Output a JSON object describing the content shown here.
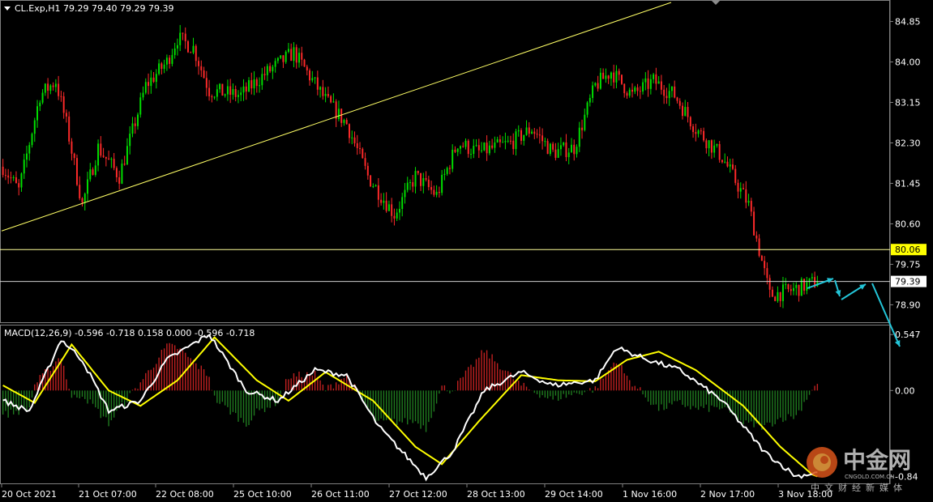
{
  "window": {
    "symbol_header": "CL.Exp,H1  79.29 79.40 79.29 79.39"
  },
  "colors": {
    "background": "#000000",
    "bull_candle": "#00e000",
    "bear_candle": "#ff2a2a",
    "trendline": "#ffff66",
    "hline": "#ffff99",
    "macd_line": "#ffffff",
    "signal_line": "#ffff00",
    "hist_pos": "#c02020",
    "hist_neg": "#1f7a1f",
    "arrow": "#23c5d8",
    "price_tag_yellow": "#ffff00",
    "price_tag_white": "#ffffff",
    "grid_border": "#808080"
  },
  "chart_data": [
    {
      "type": "candlestick",
      "title": "CL.Exp,H1",
      "ohlc_last": {
        "open": 79.29,
        "high": 79.4,
        "low": 79.29,
        "close": 79.39
      },
      "ylim": [
        78.55,
        85.25
      ],
      "y_ticks": [
        "84.85",
        "84.00",
        "83.15",
        "82.30",
        "81.45",
        "80.60",
        "79.75",
        "78.90"
      ],
      "y_tick_values": [
        84.85,
        84.0,
        83.15,
        82.3,
        81.45,
        80.6,
        79.75,
        78.9
      ],
      "x_ticks": [
        "20 Oct 2021",
        "21 Oct 07:00",
        "22 Oct 08:00",
        "25 Oct 10:00",
        "26 Oct 11:00",
        "27 Oct 12:00",
        "28 Oct 13:00",
        "29 Oct 14:00",
        "1 Nov 16:00",
        "2 Nov 17:00",
        "3 Nov 18:00"
      ],
      "horizontal_levels": [
        {
          "value": 80.06,
          "label": "80.06",
          "tag": "yellow"
        },
        {
          "value": 79.39,
          "label": "79.39",
          "tag": "white"
        }
      ],
      "trendline": {
        "from_value": 80.45,
        "to_value": 85.25
      },
      "anchors": [
        [
          0,
          81.8
        ],
        [
          6,
          81.3
        ],
        [
          14,
          83.3
        ],
        [
          20,
          83.6
        ],
        [
          24,
          82.7
        ],
        [
          30,
          81.0
        ],
        [
          36,
          82.2
        ],
        [
          44,
          81.6
        ],
        [
          54,
          83.5
        ],
        [
          62,
          84.0
        ],
        [
          66,
          84.5
        ],
        [
          72,
          84.3
        ],
        [
          78,
          83.4
        ],
        [
          90,
          83.3
        ],
        [
          98,
          83.7
        ],
        [
          110,
          84.2
        ],
        [
          122,
          83.2
        ],
        [
          130,
          82.7
        ],
        [
          138,
          81.6
        ],
        [
          148,
          80.8
        ],
        [
          156,
          81.6
        ],
        [
          164,
          81.2
        ],
        [
          172,
          82.3
        ],
        [
          180,
          82.1
        ],
        [
          192,
          82.3
        ],
        [
          200,
          82.6
        ],
        [
          208,
          82.1
        ],
        [
          216,
          82.2
        ],
        [
          224,
          83.5
        ],
        [
          230,
          83.8
        ],
        [
          238,
          83.3
        ],
        [
          246,
          83.6
        ],
        [
          254,
          83.3
        ],
        [
          262,
          82.6
        ],
        [
          272,
          82.0
        ],
        [
          282,
          81.0
        ],
        [
          290,
          79.1
        ],
        [
          298,
          79.2
        ],
        [
          308,
          79.39
        ]
      ]
    },
    {
      "type": "line",
      "title": "MACD(12,26,9) -0.596 -0.718 0.158 0.000 -0.596 -0.718",
      "ylim": [
        -0.9,
        0.62
      ],
      "y_ticks": [
        "0.547",
        "0.00",
        "-0.84"
      ],
      "y_tick_values": [
        0.547,
        0.0,
        -0.84
      ],
      "series": [
        {
          "name": "MACD",
          "values_at_anchors": [
            [
              0,
              -0.1
            ],
            [
              10,
              -0.2
            ],
            [
              22,
              0.5
            ],
            [
              30,
              0.3
            ],
            [
              40,
              -0.2
            ],
            [
              52,
              -0.1
            ],
            [
              62,
              0.3
            ],
            [
              78,
              0.55
            ],
            [
              92,
              0.0
            ],
            [
              104,
              -0.1
            ],
            [
              118,
              0.2
            ],
            [
              130,
              0.15
            ],
            [
              142,
              -0.35
            ],
            [
              160,
              -0.85
            ],
            [
              170,
              -0.6
            ],
            [
              182,
              0.0
            ],
            [
              196,
              0.18
            ],
            [
              208,
              0.05
            ],
            [
              224,
              0.1
            ],
            [
              232,
              0.42
            ],
            [
              244,
              0.3
            ],
            [
              256,
              0.2
            ],
            [
              272,
              -0.1
            ],
            [
              288,
              -0.6
            ],
            [
              300,
              -0.84
            ],
            [
              308,
              -0.8
            ]
          ]
        },
        {
          "name": "Signal",
          "values_at_anchors": [
            [
              0,
              0.05
            ],
            [
              12,
              -0.12
            ],
            [
              26,
              0.45
            ],
            [
              40,
              0.0
            ],
            [
              52,
              -0.15
            ],
            [
              66,
              0.1
            ],
            [
              80,
              0.52
            ],
            [
              96,
              0.1
            ],
            [
              108,
              -0.1
            ],
            [
              122,
              0.18
            ],
            [
              140,
              -0.1
            ],
            [
              156,
              -0.55
            ],
            [
              166,
              -0.72
            ],
            [
              180,
              -0.3
            ],
            [
              196,
              0.15
            ],
            [
              210,
              0.1
            ],
            [
              224,
              0.09
            ],
            [
              236,
              0.3
            ],
            [
              248,
              0.38
            ],
            [
              262,
              0.2
            ],
            [
              280,
              -0.15
            ],
            [
              294,
              -0.55
            ],
            [
              306,
              -0.82
            ],
            [
              308,
              -0.84
            ]
          ]
        }
      ]
    }
  ],
  "watermark": {
    "brand_cn": "中金网",
    "brand_en": "CNGOLD.COM.CN",
    "slogan_cn": "中文财经新媒体"
  }
}
